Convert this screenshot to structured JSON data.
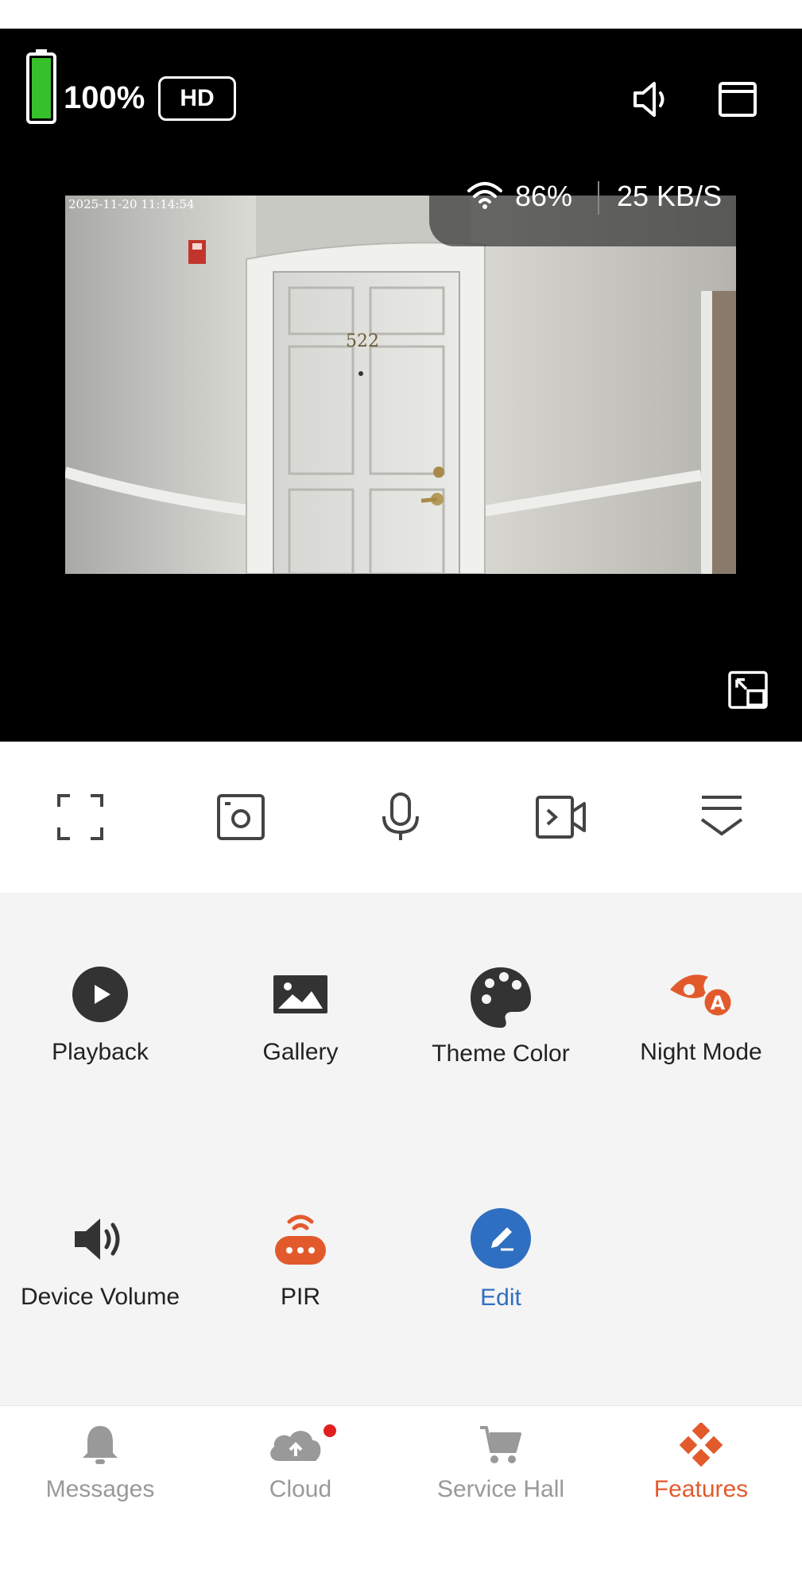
{
  "status": {
    "battery": "100%",
    "quality": "HD"
  },
  "video": {
    "timestamp": "2025-11-20 11:14:54",
    "door_number": "522",
    "signal": "86%",
    "speed": "25 KB/S"
  },
  "toolbar": {
    "items": [
      "fullscreen-icon",
      "snapshot-icon",
      "microphone-icon",
      "record-icon",
      "collapse-icon"
    ]
  },
  "features": {
    "items": [
      {
        "label": "Playback",
        "icon": "play-icon"
      },
      {
        "label": "Gallery",
        "icon": "image-icon"
      },
      {
        "label": "Theme Color",
        "icon": "palette-icon"
      },
      {
        "label": "Night Mode",
        "icon": "night-mode-icon"
      },
      {
        "label": "Device Volume",
        "icon": "speaker-icon"
      },
      {
        "label": "PIR",
        "icon": "pir-icon"
      },
      {
        "label": "Edit",
        "icon": "edit-icon"
      }
    ]
  },
  "nav": {
    "items": [
      {
        "label": "Messages",
        "icon": "bell-icon"
      },
      {
        "label": "Cloud",
        "icon": "cloud-upload-icon"
      },
      {
        "label": "Service Hall",
        "icon": "cart-icon"
      },
      {
        "label": "Features",
        "icon": "features-icon"
      }
    ],
    "active": "Features"
  },
  "colors": {
    "accent": "#e25a2c",
    "edit_blue": "#2f6fc1",
    "battery_green": "#36c02b"
  }
}
